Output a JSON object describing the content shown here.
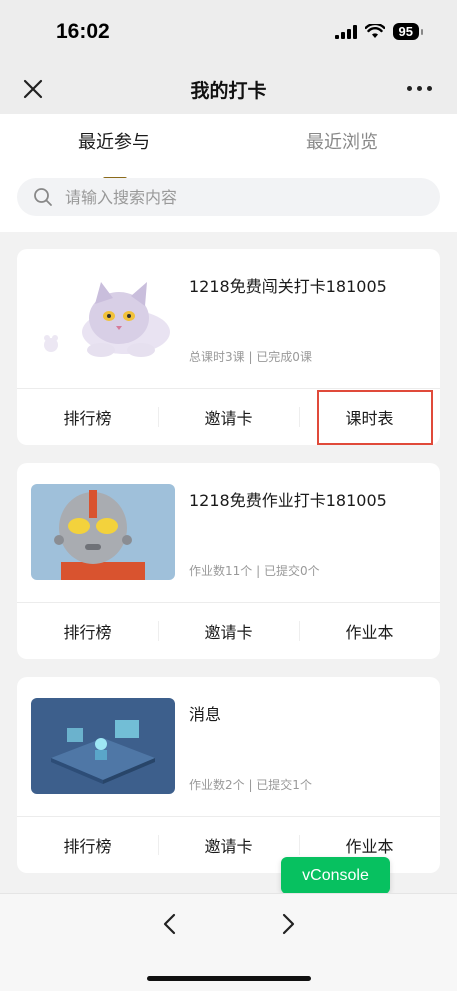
{
  "status_bar": {
    "time": "16:02",
    "battery": "95"
  },
  "nav": {
    "title": "我的打卡"
  },
  "tabs": [
    {
      "label": "最近参与",
      "active": true
    },
    {
      "label": "最近浏览",
      "active": false
    }
  ],
  "search": {
    "placeholder": "请输入搜索内容",
    "value": ""
  },
  "cards": [
    {
      "title": "1218免费闯关打卡181005",
      "meta": "总课时3课 | 已完成0课",
      "thumb": "cat-illustration",
      "actions": [
        "排行榜",
        "邀请卡",
        "课时表"
      ]
    },
    {
      "title": "1218免费作业打卡181005",
      "meta": "作业数11个 | 已提交0个",
      "thumb": "robot-hero-illustration",
      "actions": [
        "排行榜",
        "邀请卡",
        "作业本"
      ]
    },
    {
      "title": "消息",
      "meta": "作业数2个 | 已提交1个",
      "thumb": "isometric-tech-illustration",
      "actions": [
        "排行榜",
        "邀请卡",
        "作业本"
      ]
    }
  ],
  "vconsole": {
    "label": "vConsole"
  },
  "colors": {
    "accent": "#8b6a1a",
    "vconsole_green": "#07c160",
    "highlight_red": "#e04a3a"
  },
  "icons": [
    "close-icon",
    "more-icon",
    "search-icon",
    "back-arrow-icon",
    "forward-arrow-icon",
    "signal-icon",
    "wifi-icon",
    "battery-icon"
  ]
}
